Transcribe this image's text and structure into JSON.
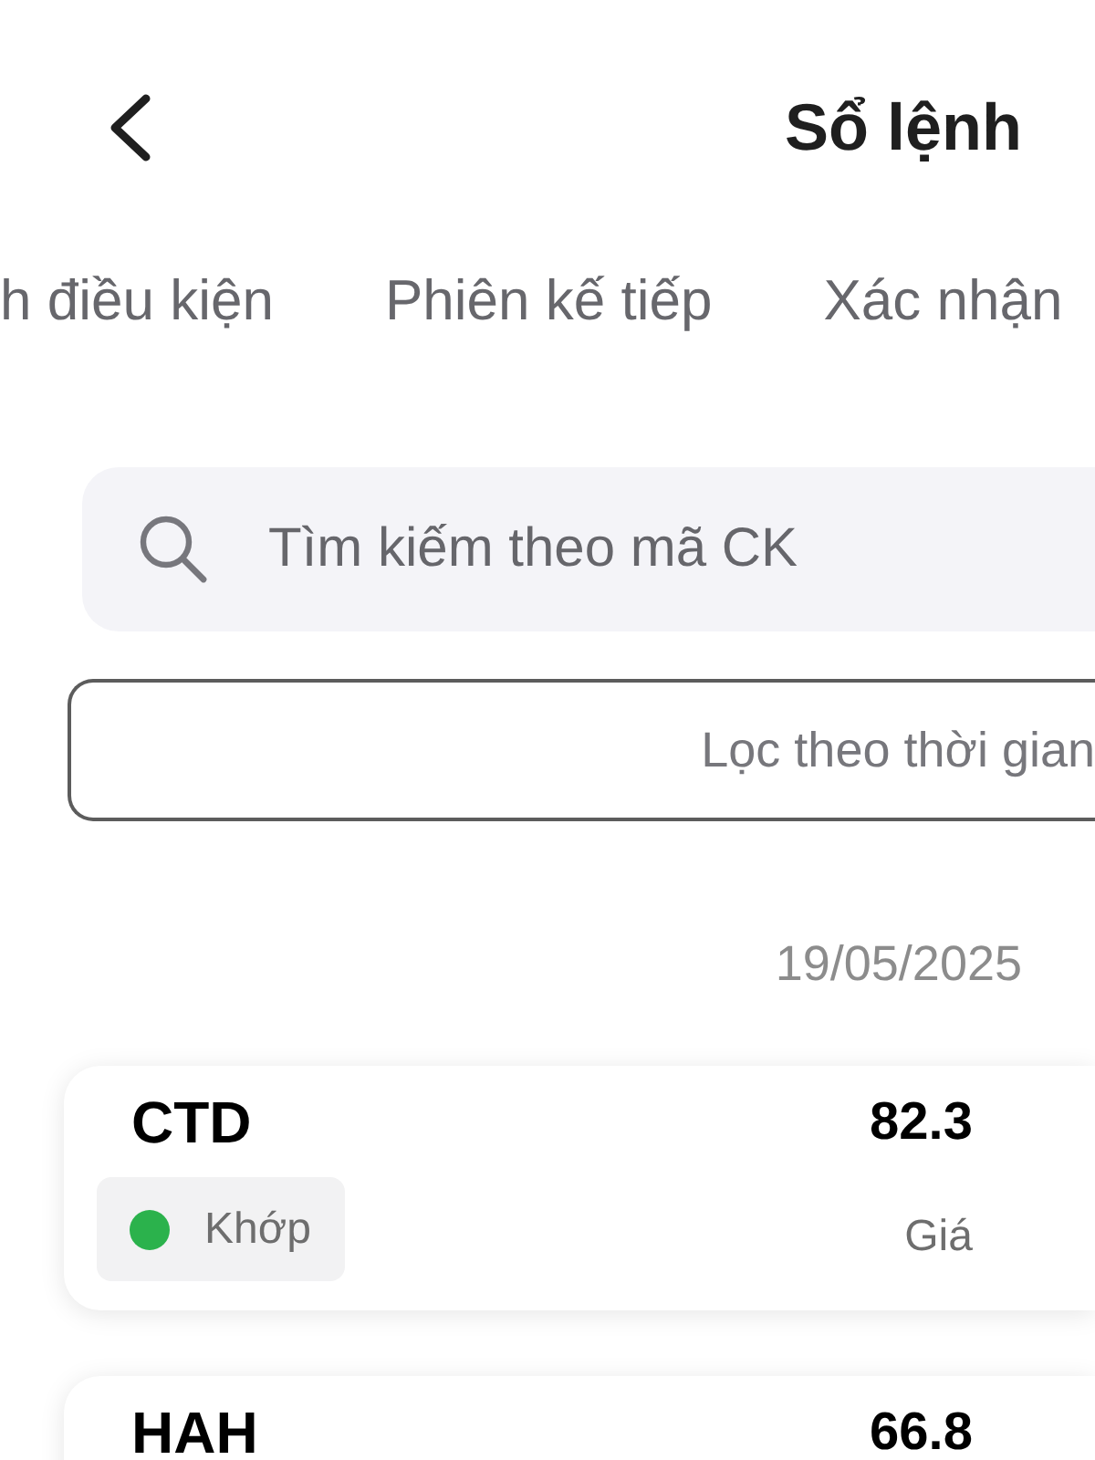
{
  "header": {
    "title": "Sổ lệnh"
  },
  "tabs": [
    {
      "label": "h điều kiện"
    },
    {
      "label": "Phiên kế tiếp"
    },
    {
      "label": "Xác nhận"
    }
  ],
  "search": {
    "placeholder": "Tìm kiếm theo mã CK"
  },
  "time_filter": {
    "label": "Lọc theo thời gian"
  },
  "date_group": "19/05/2025",
  "orders": [
    {
      "symbol": "CTD",
      "price": "82.3",
      "status": {
        "label": "Khớp",
        "color": "#2bb24c"
      },
      "price_label": "Giá"
    },
    {
      "symbol": "HAH",
      "price": "66.8"
    }
  ]
}
